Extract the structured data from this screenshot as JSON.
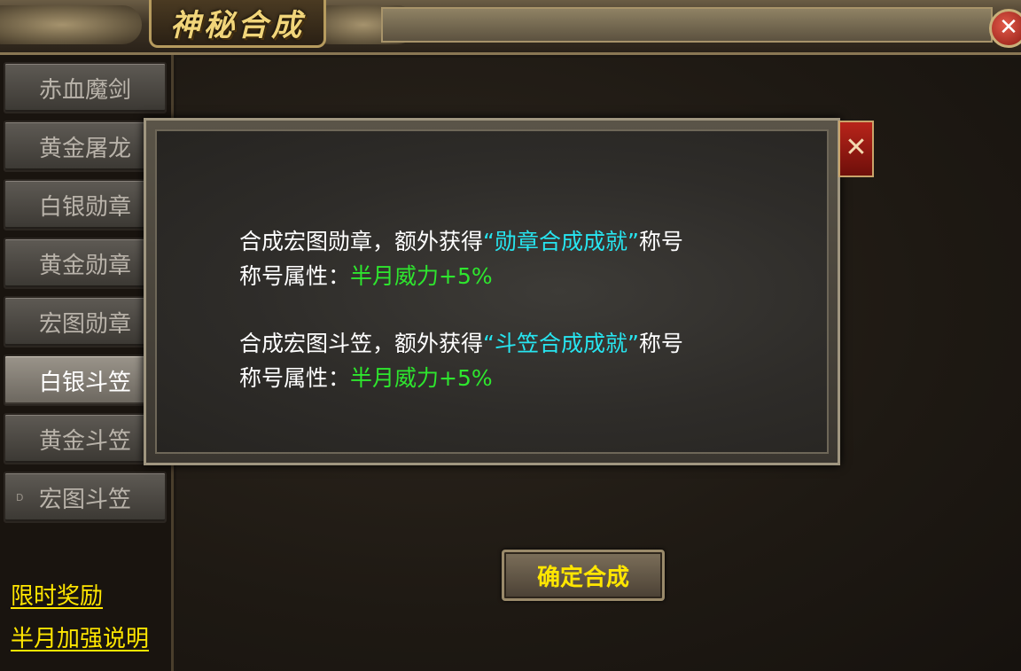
{
  "window": {
    "title": "神秘合成",
    "close_icon": "close-icon"
  },
  "sidebar": {
    "items": [
      {
        "label": "赤血魔剑",
        "active": false
      },
      {
        "label": "黄金屠龙",
        "active": false
      },
      {
        "label": "白银勋章",
        "active": false
      },
      {
        "label": "黄金勋章",
        "active": false
      },
      {
        "label": "宏图勋章",
        "active": false
      },
      {
        "label": "白银斗笠",
        "active": true
      },
      {
        "label": "黄金斗笠",
        "active": false
      },
      {
        "label": "宏图斗笠",
        "active": false,
        "marker": "D"
      }
    ],
    "links": [
      {
        "label": "限时奖励"
      },
      {
        "label": "半月加强说明"
      }
    ]
  },
  "main": {
    "confirm_label": "确定合成"
  },
  "popup": {
    "entries": [
      {
        "line1_prefix": "合成宏图勋章，额外获得",
        "title_name": "“勋章合成成就”",
        "line1_suffix": "称号",
        "attr_label": "称号属性：",
        "attr_value": "半月威力+5%"
      },
      {
        "line1_prefix": "合成宏图斗笠，额外获得",
        "title_name": "“斗笠合成成就”",
        "line1_suffix": "称号",
        "attr_label": "称号属性：",
        "attr_value": "半月威力+5%"
      }
    ],
    "close_icon": "close-icon"
  },
  "colors": {
    "accent_yellow": "#ffe600",
    "title_cyan": "#27e5f0",
    "attr_green": "#2ee62e",
    "close_red": "#b8241a"
  }
}
